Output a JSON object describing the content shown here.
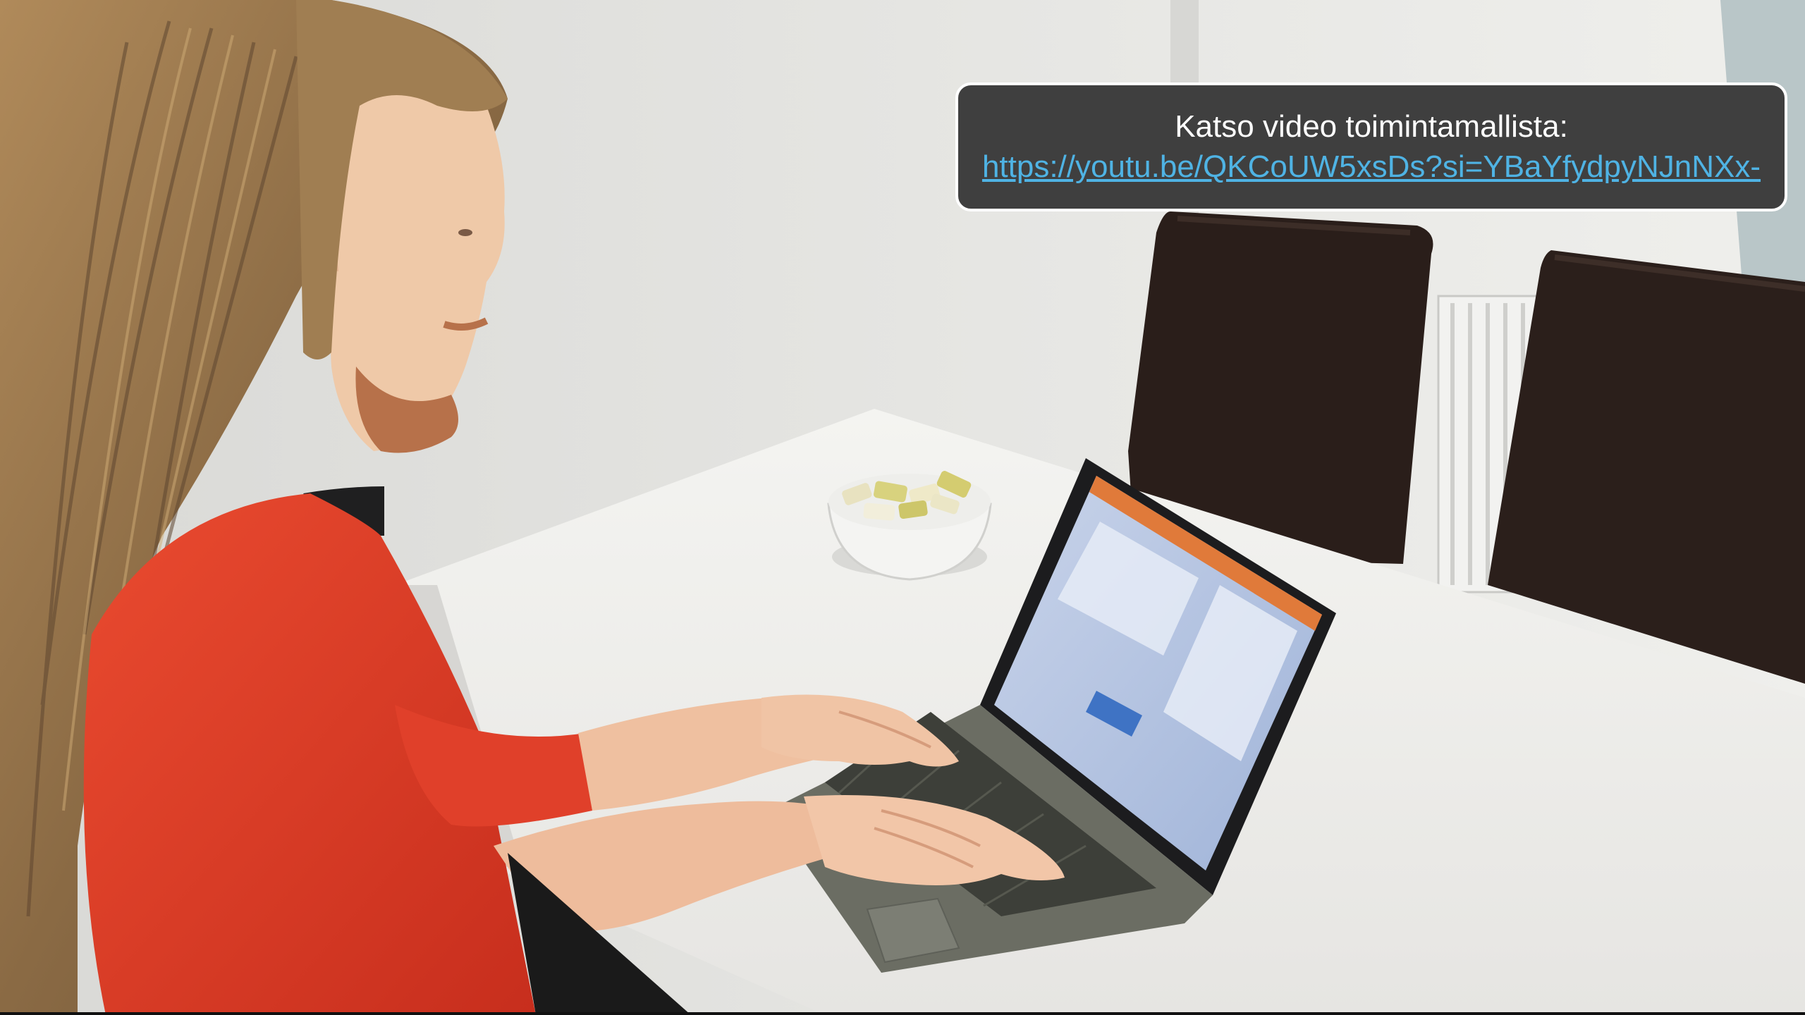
{
  "callout": {
    "heading": "Katso video toimintamallista:",
    "link_text": "https://youtu.be/QKCoUW5xsDs?si=YBaYfydpyNJnNXx-",
    "link_color": "#4fb3e4",
    "background_color": "#3f3f3f",
    "border_color": "#ffffff"
  },
  "scene": {
    "description_icons": [
      "person-figure",
      "laptop",
      "candy-bowl",
      "chair",
      "radiator",
      "table"
    ],
    "shirt_color": "#e03a25",
    "table_color": "#ecebe8",
    "wall_color": "#e3e3e0"
  }
}
